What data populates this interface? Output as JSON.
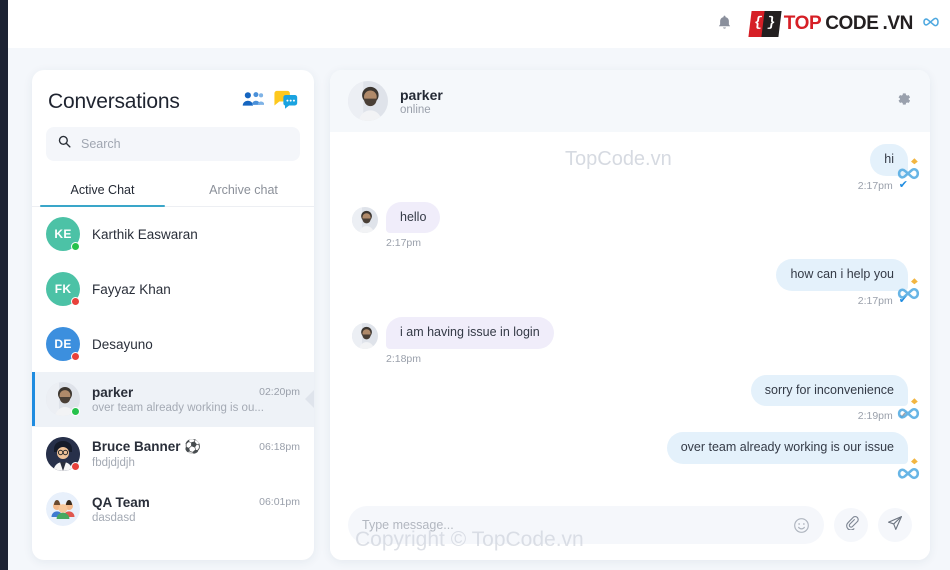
{
  "topbar": {
    "bell_icon": "bell-icon",
    "brand": {
      "bracket_left": "{",
      "bracket_right": "}",
      "top": "TOP",
      "code": "CODE",
      "vn": ".VN"
    }
  },
  "sidebar": {
    "title": "Conversations",
    "icons": [
      "people-icon",
      "chats-icon"
    ],
    "search": {
      "placeholder": "Search",
      "value": "",
      "icon": "search-icon"
    },
    "tabs": [
      {
        "label": "Active Chat",
        "active": true
      },
      {
        "label": "Archive chat",
        "active": false
      }
    ],
    "contacts": [
      {
        "name": "Karthik Easwaran",
        "initials": "KE",
        "color": "#4cc2a6",
        "status": "online",
        "time": "",
        "preview": "",
        "selected": false,
        "avatar_type": "initials"
      },
      {
        "name": "Fayyaz Khan",
        "initials": "FK",
        "color": "#4cc2a6",
        "status": "offline",
        "time": "",
        "preview": "",
        "selected": false,
        "avatar_type": "initials"
      },
      {
        "name": "Desayuno",
        "initials": "DE",
        "color": "#3c8fde",
        "status": "offline",
        "time": "",
        "preview": "",
        "selected": false,
        "avatar_type": "initials"
      },
      {
        "name": "parker",
        "initials": "",
        "color": "#cfd6e0",
        "status": "online",
        "time": "02:20pm",
        "preview": "over team already working is ou...",
        "selected": true,
        "avatar_type": "photo"
      },
      {
        "name": "Bruce Banner ⚽",
        "initials": "",
        "color": "#2f3b55",
        "status": "offline",
        "time": "06:18pm",
        "preview": "fbdjdjdjh",
        "selected": false,
        "avatar_type": "emoji",
        "emoji": "🧑‍🎓"
      },
      {
        "name": "QA Team",
        "initials": "",
        "color": "#dfe9f7",
        "status": "none",
        "time": "06:01pm",
        "preview": "dasdasd",
        "selected": false,
        "avatar_type": "emoji",
        "emoji": "👪"
      }
    ]
  },
  "chat": {
    "header": {
      "name": "parker",
      "status": "online",
      "gear_icon": "gear-icon"
    },
    "messages": [
      {
        "dir": "out",
        "text": "hi",
        "time": "2:17pm",
        "tick": "read"
      },
      {
        "dir": "in",
        "text": "hello",
        "time": "2:17pm",
        "tick": ""
      },
      {
        "dir": "out",
        "text": "how can i help you",
        "time": "2:17pm",
        "tick": "read"
      },
      {
        "dir": "in",
        "text": "i am having issue in login",
        "time": "2:18pm",
        "tick": ""
      },
      {
        "dir": "out",
        "text": "sorry for inconvenience",
        "time": "2:19pm",
        "tick": "sent"
      },
      {
        "dir": "out",
        "text": "over team already working is our issue",
        "time": "",
        "tick": ""
      }
    ],
    "composer": {
      "placeholder": "Type message...",
      "value": "",
      "emoji_icon": "emoji-icon",
      "attach_icon": "paperclip-icon",
      "send_icon": "send-icon"
    }
  },
  "watermarks": {
    "top": "TopCode.vn",
    "bottom": "Copyright © TopCode.vn"
  },
  "colors": {
    "accent_blue": "#1f8ce0",
    "tab_underline": "#3aa6c9",
    "bubble_out": "#e4f1fb",
    "bubble_in": "#f0edfa",
    "brand_red": "#d61f26",
    "online": "#27c24c",
    "offline": "#e8413b"
  }
}
